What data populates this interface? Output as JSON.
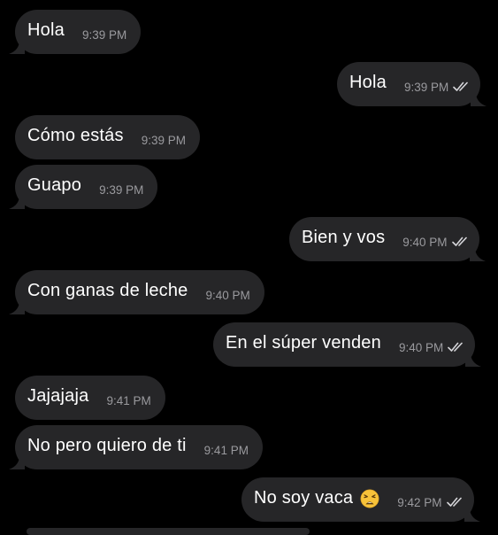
{
  "messages": [
    {
      "direction": "in",
      "text": "Hola",
      "time": "9:39 PM"
    },
    {
      "direction": "out",
      "text": "Hola",
      "time": "9:39 PM",
      "read": true
    },
    {
      "direction": "in",
      "text": "Cómo estás",
      "time": "9:39 PM"
    },
    {
      "direction": "in",
      "text": "Guapo",
      "time": "9:39 PM"
    },
    {
      "direction": "out",
      "text": "Bien y vos",
      "time": "9:40 PM",
      "read": true
    },
    {
      "direction": "in",
      "text": "Con ganas de leche",
      "time": "9:40 PM"
    },
    {
      "direction": "out",
      "text": "En el súper venden",
      "time": "9:40 PM",
      "read": true
    },
    {
      "direction": "in",
      "text": "Jajajaja",
      "time": "9:41 PM"
    },
    {
      "direction": "in",
      "text": "No pero quiero de ti",
      "time": "9:41 PM"
    },
    {
      "direction": "out",
      "text": "No soy vaca",
      "emoji": "weary-face",
      "time": "9:42 PM",
      "read": true
    }
  ],
  "colors": {
    "background": "#000000",
    "bubble": "#262628",
    "text": "#ffffff",
    "timestamp": "#9a9a9e"
  }
}
